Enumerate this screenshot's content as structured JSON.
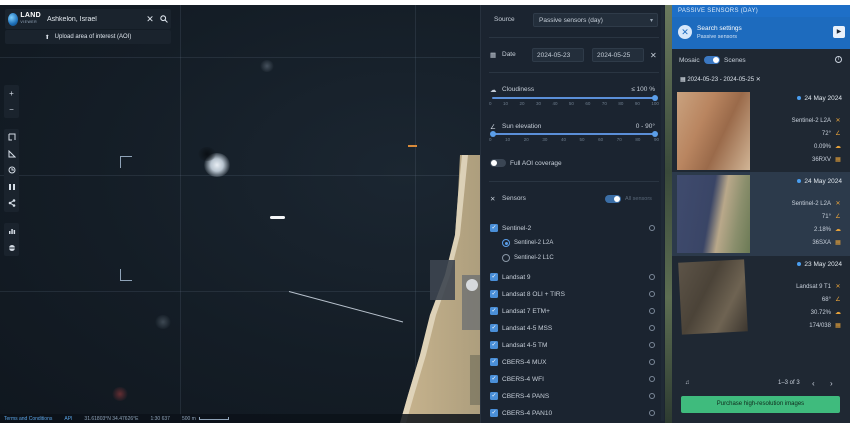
{
  "search": {
    "logo_text": "LAND",
    "logo_subtext": "VIEWER",
    "value": "Ashkelon, Israel",
    "upload_label": "Upload area of interest (AOI)"
  },
  "status": {
    "terms": "Terms and Conditions",
    "api": "API",
    "coords": "31.61803°N 34.47626°E",
    "scale_ratio": "1:30 637",
    "scale_length": "500 m"
  },
  "settings": {
    "source_label": "Source",
    "source_value": "Passive sensors (day)",
    "date_label": "Date",
    "date_from": "2024-05-23",
    "date_to": "2024-05-25",
    "cloud_label": "Cloudiness",
    "cloud_value": "≤ 100 %",
    "cloud_ticks": [
      "0",
      "10",
      "20",
      "30",
      "40",
      "50",
      "60",
      "70",
      "80",
      "90",
      "100"
    ],
    "sun_label": "Sun elevation",
    "sun_value": "0 - 90°",
    "sun_ticks": [
      "0",
      "10",
      "20",
      "30",
      "40",
      "50",
      "60",
      "70",
      "80",
      "90"
    ],
    "aoi_label": "Full AOI coverage",
    "sensors_label": "Sensors",
    "all_sensors_label": "All sensors",
    "sensors": [
      {
        "name": "Sentinel-2",
        "children": [
          "Sentinel-2 L2A",
          "Sentinel-2 L1C"
        ]
      },
      {
        "name": "Landsat 9"
      },
      {
        "name": "Landsat 8 OLI + TIRS"
      },
      {
        "name": "Landsat 7 ETM+"
      },
      {
        "name": "Landsat 4-5 MSS"
      },
      {
        "name": "Landsat 4-5 TM"
      },
      {
        "name": "CBERS-4 MUX"
      },
      {
        "name": "CBERS-4 WFI"
      },
      {
        "name": "CBERS-4 PANS"
      },
      {
        "name": "CBERS-4 PAN10"
      }
    ]
  },
  "results": {
    "header": "PASSIVE SENSORS (DAY)",
    "search_settings_title": "Search settings",
    "search_settings_sub": "Passive sensors",
    "mosaic_label": "Mosaic",
    "scenes_label": "Scenes",
    "date_chip": "2024-05-23 - 2024-05-25",
    "scenes": [
      {
        "date": "24 May 2024",
        "sensor": "Sentinel-2  L2A",
        "sun": "72°",
        "cloud": "0.09%",
        "tile": "36RXV"
      },
      {
        "date": "24 May 2024",
        "sensor": "Sentinel-2  L2A",
        "sun": "71°",
        "cloud": "2.18%",
        "tile": "36SXA"
      },
      {
        "date": "23 May 2024",
        "sensor": "Landsat  9  T1",
        "sun": "68°",
        "cloud": "30.72%",
        "tile": "174/038"
      }
    ],
    "pager_text": "1–3 of 3",
    "buy_label": "Purchase high-resolution images"
  },
  "colors": {
    "accent": "#1e6fc7",
    "checkbox": "#4a8fd8",
    "buy_button": "#3fbb7d",
    "panel_bg": "#1b2430"
  }
}
